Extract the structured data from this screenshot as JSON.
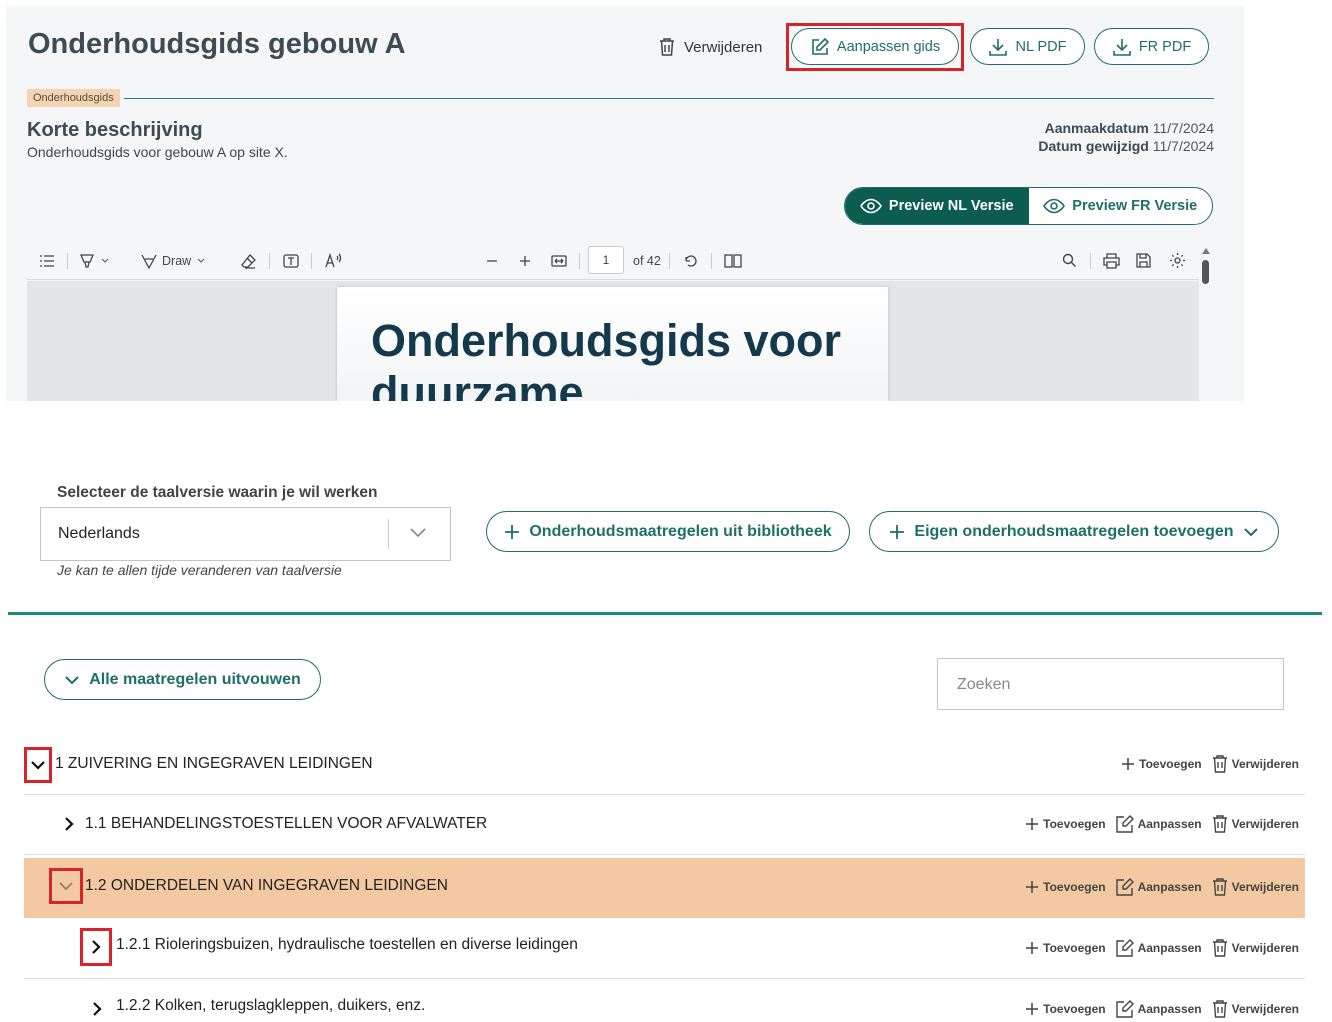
{
  "header": {
    "title": "Onderhoudsgids gebouw A",
    "delete_label": "Verwijderen",
    "edit_label": "Aanpassen gids",
    "nl_pdf_label": "NL PDF",
    "fr_pdf_label": "FR PDF"
  },
  "tag": "Onderhoudsgids",
  "description": {
    "title": "Korte beschrijving",
    "text": "Onderhoudsgids voor gebouw A op site X."
  },
  "meta": {
    "created_label": "Aanmaakdatum",
    "created_value": "11/7/2024",
    "modified_label": "Datum gewijzigd",
    "modified_value": "11/7/2024"
  },
  "preview": {
    "nl_label": "Preview NL Versie",
    "fr_label": "Preview FR Versie"
  },
  "pdf_viewer": {
    "draw_label": "Draw",
    "page_value": "1",
    "page_total": "of 42",
    "page_title": "Onderhoudsgids voor duurzame"
  },
  "language": {
    "label": "Selecteer de taalversie waarin je wil werken",
    "selected": "Nederlands",
    "help": "Je kan te allen tijde veranderen van taalversie"
  },
  "actions": {
    "library_label": "Onderhoudsmaatregelen uit bibliotheek",
    "own_label": "Eigen onderhoudsmaatregelen toevoegen",
    "expand_all_label": "Alle maatregelen uitvouwen",
    "search_placeholder": "Zoeken"
  },
  "row_actions": {
    "add": "Toevoegen",
    "edit": "Aanpassen",
    "delete": "Verwijderen"
  },
  "tree": [
    {
      "label": "1 ZUIVERING EN INGEGRAVEN LEIDINGEN"
    },
    {
      "label": "1.1 BEHANDELINGSTOESTELLEN VOOR AFVALWATER"
    },
    {
      "label": "1.2 ONDERDELEN VAN INGEGRAVEN LEIDINGEN"
    },
    {
      "label": "1.2.1 Rioleringsbuizen, hydraulische toestellen en diverse leidingen"
    },
    {
      "label": "1.2.2 Kolken, terugslagkleppen, duikers, enz."
    }
  ],
  "colors": {
    "accent": "#1f6f6a",
    "accent_dark": "#0d5c50",
    "highlight_row": "#f3c9a2",
    "annotation_red": "#d9232a"
  }
}
